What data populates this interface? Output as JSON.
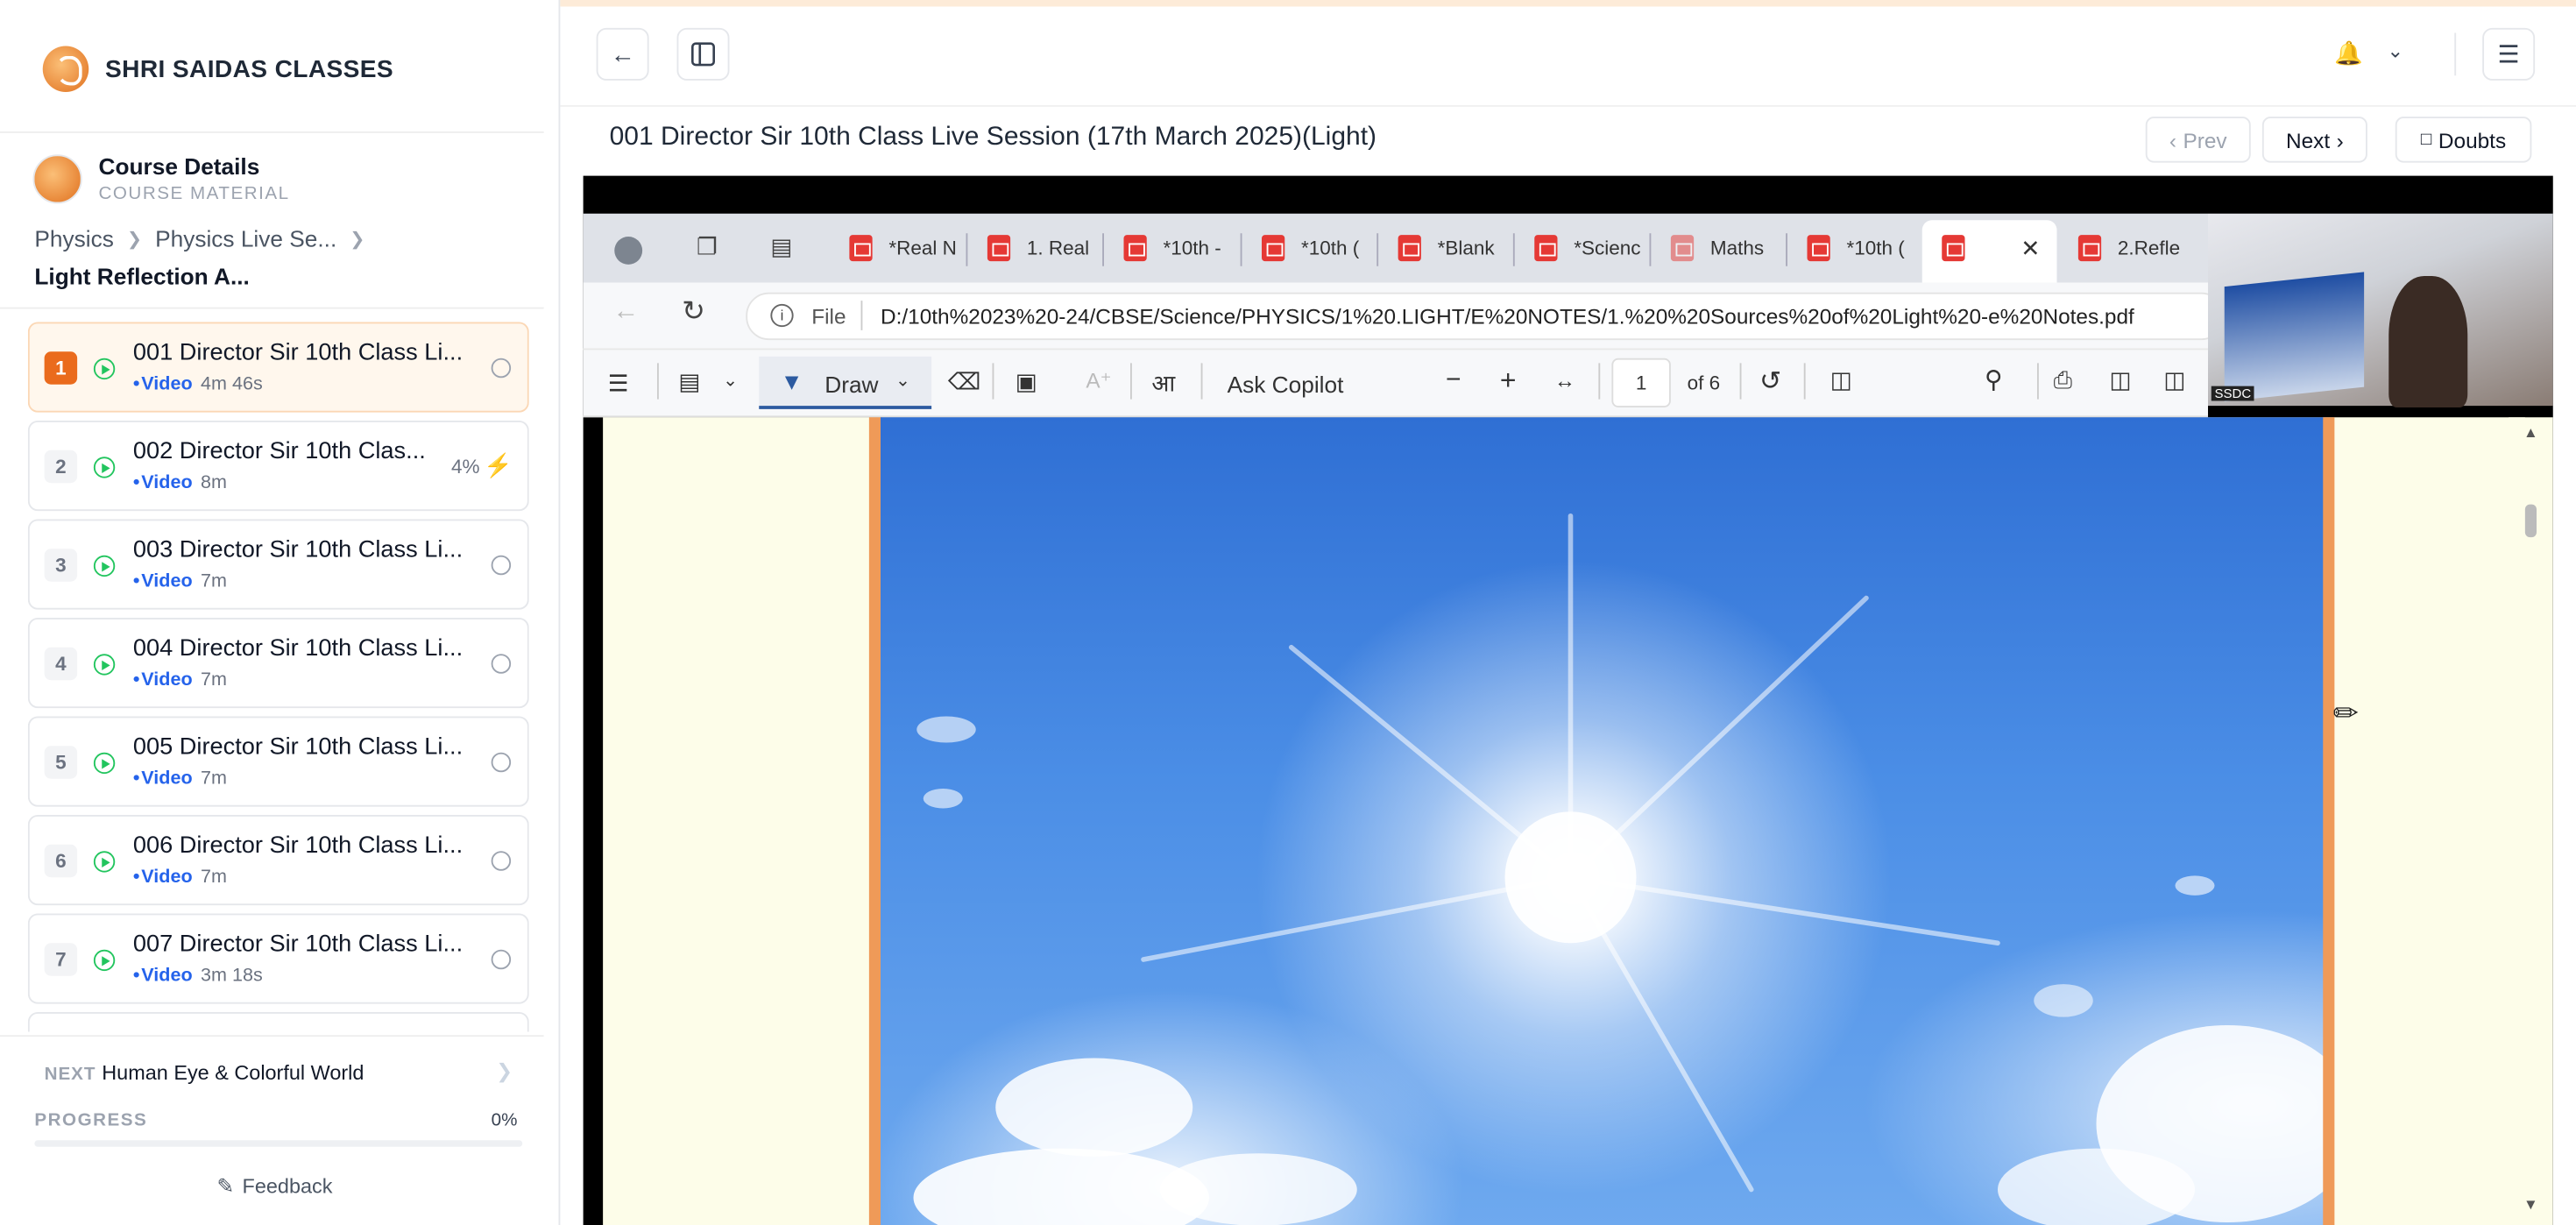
{
  "brand": {
    "name": "SHRI SAIDAS CLASSES"
  },
  "course": {
    "title": "Course Details",
    "subtitle": "COURSE MATERIAL"
  },
  "breadcrumb": {
    "items": [
      "Physics",
      "Physics Live Se..."
    ],
    "current": "Light Reflection A..."
  },
  "lessons": [
    {
      "num": "1",
      "title": "001 Director Sir 10th Class Li...",
      "type": "Video",
      "duration": "4m 46s",
      "active": true
    },
    {
      "num": "2",
      "title": "002 Director Sir 10th Clas...",
      "type": "Video",
      "duration": "8m",
      "progress": "4%"
    },
    {
      "num": "3",
      "title": "003 Director Sir 10th Class Li...",
      "type": "Video",
      "duration": "7m"
    },
    {
      "num": "4",
      "title": "004 Director Sir 10th Class Li...",
      "type": "Video",
      "duration": "7m"
    },
    {
      "num": "5",
      "title": "005 Director Sir 10th Class Li...",
      "type": "Video",
      "duration": "7m"
    },
    {
      "num": "6",
      "title": "006 Director Sir 10th Class Li...",
      "type": "Video",
      "duration": "7m"
    },
    {
      "num": "7",
      "title": "007 Director Sir 10th Class Li...",
      "type": "Video",
      "duration": "3m 18s"
    }
  ],
  "next": {
    "label": "NEXT",
    "value": "Human Eye & Colorful World"
  },
  "progress": {
    "label": "PROGRESS",
    "value": "0%",
    "fraction": 0
  },
  "feedback": {
    "label": "Feedback"
  },
  "header": {
    "title": "001 Director Sir 10th Class Live Session (17th March 2025)(Light)",
    "prev_label": "Prev",
    "next_label": "Next",
    "doubts_label": "Doubts"
  },
  "video": {
    "tabs": [
      "*Real N",
      "1. Real",
      "*10th -",
      "*10th (",
      "*Blank",
      "*Scienc",
      "Maths",
      "*10th (",
      "",
      "2.Refle"
    ],
    "url_scheme": "File",
    "url": "D:/10th%2023%20-24/CBSE/Science/PHYSICS/1%20.LIGHT/E%20NOTES/1.%20%20Sources%20of%20Light%20-e%20Notes.pdf",
    "toolbar": {
      "draw_label": "Draw",
      "copilot_label": "Ask Copilot",
      "page_value": "1",
      "page_total": "of 6"
    },
    "webcam_tag": "SSDC"
  },
  "colors": {
    "accent": "#ea6b1d",
    "video_type": "#2563eb",
    "play_icon": "#22c55e"
  }
}
